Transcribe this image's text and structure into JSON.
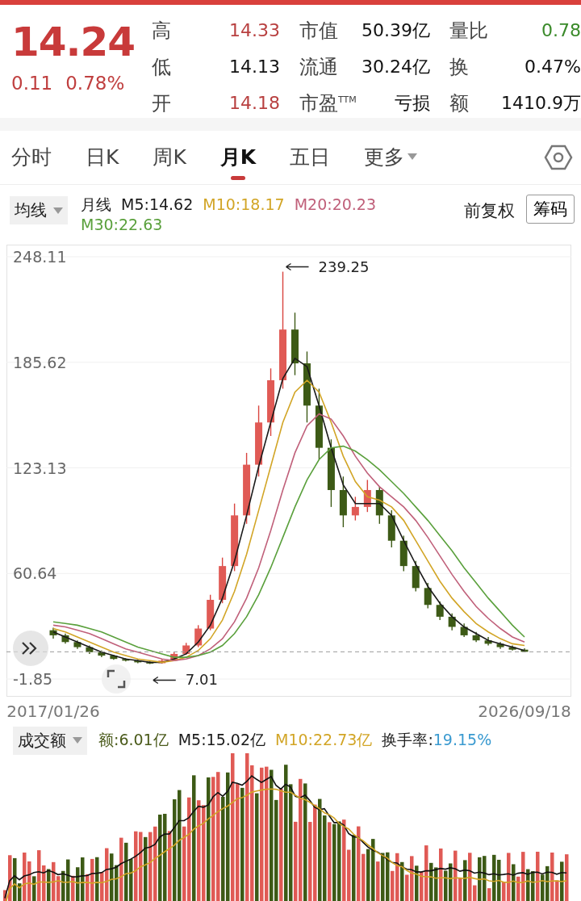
{
  "quote": {
    "price": "14.24",
    "change": "0.11",
    "change_pct": "0.78%",
    "fields": [
      {
        "label": "高",
        "value": "14.33",
        "color": "#b84040"
      },
      {
        "label": "市值",
        "value": "50.39亿",
        "color": "#111111"
      },
      {
        "label": "量比",
        "value": "0.78",
        "color": "#3a8a2a"
      },
      {
        "label": "低",
        "value": "14.13",
        "color": "#111111"
      },
      {
        "label": "流通",
        "value": "30.24亿",
        "color": "#111111"
      },
      {
        "label": "换",
        "value": "0.47%",
        "color": "#111111"
      },
      {
        "label": "开",
        "value": "14.18",
        "color": "#b84040"
      },
      {
        "label": "市盈$^{TTM}$",
        "value": "亏损",
        "color": "#111111"
      },
      {
        "label": "额",
        "value": "1410.9万",
        "color": "#111111"
      }
    ]
  },
  "tabs": [
    {
      "label": "分时",
      "selected": false
    },
    {
      "label": "日K",
      "selected": false
    },
    {
      "label": "周K",
      "selected": false
    },
    {
      "label": "月K",
      "selected": true
    },
    {
      "label": "五日",
      "selected": false
    },
    {
      "label": "更多",
      "selected": false
    }
  ],
  "legend": {
    "selector": "均线",
    "period": "月线",
    "adjust": "前复权",
    "chips_button": "筹码"
  },
  "chart": {
    "chart_data": {
      "type": "candlestick",
      "grid": true,
      "ylim": [
        -1.85,
        248.11
      ],
      "yticks": [
        248.11,
        185.62,
        123.13,
        60.64,
        -1.85
      ],
      "categories": [
        "2017/01/26",
        null,
        null,
        null,
        null,
        null,
        null,
        null,
        null,
        null,
        null,
        null,
        null,
        null,
        null,
        null,
        null,
        null,
        null,
        null,
        null,
        null,
        null,
        null,
        null,
        null,
        null,
        null,
        null,
        null,
        null,
        null,
        null,
        null,
        null,
        null,
        null,
        null,
        null,
        "2026/09/18"
      ],
      "ohlc": [
        [
          27,
          28.5,
          22,
          24
        ],
        [
          24,
          25,
          19,
          20
        ],
        [
          20,
          21,
          16,
          17
        ],
        [
          17,
          18,
          13,
          14
        ],
        [
          14,
          15,
          11,
          12
        ],
        [
          12,
          12.5,
          9.5,
          10
        ],
        [
          10,
          10.5,
          8.5,
          9
        ],
        [
          9,
          9.5,
          7.5,
          8
        ],
        [
          8,
          8.6,
          7.01,
          7.5
        ],
        [
          7.5,
          9.8,
          7.3,
          9
        ],
        [
          9,
          14,
          8.8,
          13
        ],
        [
          13,
          19.5,
          12.5,
          18
        ],
        [
          18,
          30,
          17,
          28
        ],
        [
          28,
          48,
          27,
          45
        ],
        [
          45,
          70,
          43,
          65
        ],
        [
          65,
          102,
          62,
          95
        ],
        [
          95,
          132,
          90,
          125
        ],
        [
          125,
          160,
          118,
          150
        ],
        [
          150,
          182,
          142,
          175
        ],
        [
          175,
          239.25,
          170,
          205
        ],
        [
          205,
          215,
          178,
          185
        ],
        [
          185,
          192,
          150,
          160
        ],
        [
          160,
          170,
          128,
          135
        ],
        [
          135,
          140,
          100,
          110
        ],
        [
          110,
          118,
          88,
          95
        ],
        [
          95,
          106,
          92,
          100
        ],
        [
          100,
          116,
          97,
          110
        ],
        [
          110,
          112,
          90,
          95
        ],
        [
          95,
          98,
          76,
          80
        ],
        [
          80,
          83,
          62,
          65
        ],
        [
          65,
          68,
          50,
          52
        ],
        [
          52,
          55,
          40,
          42
        ],
        [
          42,
          44,
          33,
          35
        ],
        [
          35,
          37,
          27,
          29
        ],
        [
          29,
          31,
          23,
          24
        ],
        [
          24,
          26,
          20,
          21
        ],
        [
          21,
          23,
          18,
          19
        ],
        [
          19,
          20,
          16,
          17
        ],
        [
          17,
          18,
          15,
          15.5
        ],
        [
          15.5,
          16.3,
          14.1,
          14.24
        ]
      ],
      "series": [
        {
          "name": "M5:14.62",
          "type": "line",
          "color": "#1a1a1a",
          "values": [
            26,
            23,
            20,
            17,
            14,
            12,
            10,
            9,
            8,
            8,
            10,
            13,
            20,
            30,
            46,
            68,
            95,
            124,
            150,
            176,
            188,
            183,
            160,
            135,
            113,
            102,
            102,
            102,
            95,
            80,
            66,
            53,
            43,
            35,
            29,
            25,
            21,
            19,
            17,
            15
          ]
        },
        {
          "name": "M10:18.17",
          "type": "line",
          "color": "#d2a526",
          "values": [
            28,
            26,
            23,
            20,
            17,
            14,
            12,
            10,
            9,
            8,
            9,
            11,
            15,
            22,
            33,
            50,
            72,
            98,
            124,
            150,
            168,
            175,
            168,
            150,
            130,
            115,
            106,
            104,
            100,
            92,
            80,
            68,
            56,
            46,
            38,
            31,
            26,
            22,
            19,
            18
          ]
        },
        {
          "name": "M20:20.23",
          "type": "line",
          "color": "#c0607a",
          "values": [
            30,
            29,
            27,
            25,
            22,
            19,
            16,
            14,
            12,
            10,
            9,
            10,
            12,
            16,
            22,
            32,
            46,
            64,
            86,
            110,
            132,
            148,
            155,
            152,
            142,
            130,
            120,
            112,
            106,
            100,
            92,
            82,
            71,
            60,
            50,
            41,
            34,
            28,
            23,
            20
          ]
        },
        {
          "name": "M30:22.63",
          "type": "line",
          "color": "#5aa03c",
          "values": [
            32,
            31,
            30,
            28,
            26,
            23,
            20,
            17,
            15,
            13,
            11,
            11,
            12,
            14,
            18,
            25,
            35,
            48,
            64,
            82,
            100,
            116,
            128,
            135,
            136,
            133,
            128,
            122,
            115,
            108,
            100,
            92,
            83,
            74,
            64,
            55,
            46,
            38,
            30,
            23
          ]
        }
      ],
      "annotations": [
        "239.25",
        "7.01"
      ],
      "ref_lines": [
        {
          "axis": "y",
          "value": 14.24
        }
      ]
    }
  },
  "volume": {
    "selector": "成交额",
    "items": [
      {
        "label": "额:6.01亿",
        "color": "#4a5a1a"
      },
      {
        "label": "M5:15.02亿",
        "color": "#1a1a1a"
      },
      {
        "label": "M10:22.73亿",
        "color": "#d2a526"
      }
    ],
    "turnover": {
      "label": "换手率:",
      "value": "19.15%"
    }
  }
}
